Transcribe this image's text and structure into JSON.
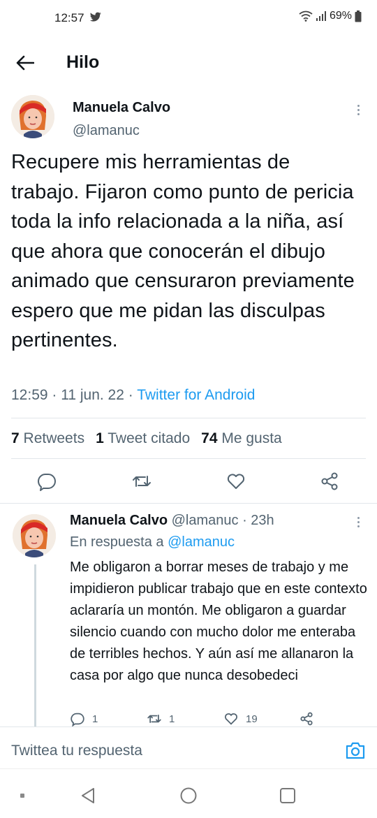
{
  "status_bar": {
    "time": "12:57",
    "battery": "69%"
  },
  "header": {
    "title": "Hilo"
  },
  "main_tweet": {
    "author_name": "Manuela Calvo",
    "author_handle": "@lamanuc",
    "text": "Recupere mis herramientas de trabajo. Fijaron como punto de pericia toda la info relacionada a la niña, así que ahora que conocerán el dibujo animado que censuraron previamente espero que me pidan las disculpas pertinentes.",
    "time": "12:59",
    "date": "11 jun. 22",
    "source": "Twitter for Android",
    "stats": {
      "retweets_count": "7",
      "retweets_label": "Retweets",
      "quotes_count": "1",
      "quotes_label": "Tweet citado",
      "likes_count": "74",
      "likes_label": "Me gusta"
    }
  },
  "reply_tweet": {
    "author_name": "Manuela Calvo",
    "author_handle": "@lamanuc",
    "age": "23h",
    "reply_prefix": "En respuesta a",
    "reply_to_handle": "@lamanuc",
    "text": "Me obligaron a borrar meses de trabajo y me impidieron publicar trabajo que en este contexto aclararía un montón. Me obligaron a guardar silencio cuando con mucho dolor me enteraba de terribles hechos. Y aún así me allanaron la casa por algo que nunca desobedeci",
    "replies": "1",
    "retweets": "1",
    "likes": "19"
  },
  "compose": {
    "placeholder": "Twittea tu respuesta"
  },
  "colors": {
    "accent": "#1d9bf0",
    "text": "#0f1419",
    "muted": "#536471"
  }
}
